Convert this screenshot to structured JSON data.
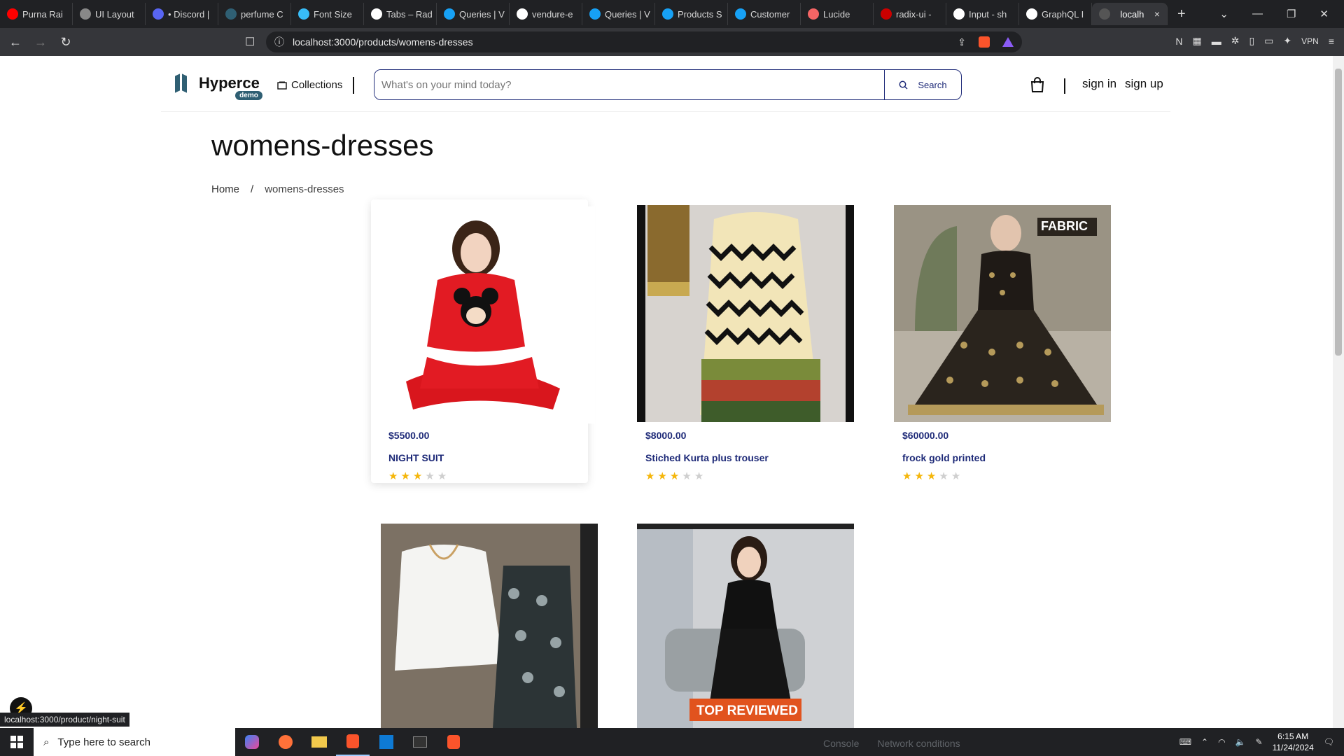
{
  "browser": {
    "tabs": [
      {
        "label": "Purna Rai",
        "color": "#ff0000"
      },
      {
        "label": "UI Layout",
        "color": "#888888"
      },
      {
        "label": "• Discord |",
        "color": "#5865f2"
      },
      {
        "label": "perfume C",
        "color": "#2f5f73"
      },
      {
        "label": "Font Size",
        "color": "#38bdf8"
      },
      {
        "label": "Tabs – Rad",
        "color": "#ffffff"
      },
      {
        "label": "Queries | V",
        "color": "#17a1f5"
      },
      {
        "label": "vendure-e",
        "color": "#ffffff"
      },
      {
        "label": "Queries | V",
        "color": "#17a1f5"
      },
      {
        "label": "Products S",
        "color": "#17a1f5"
      },
      {
        "label": "Customer",
        "color": "#17a1f5"
      },
      {
        "label": "Lucide",
        "color": "#f56565"
      },
      {
        "label": "radix-ui -",
        "color": "#cc0000"
      },
      {
        "label": "Input - sh",
        "color": "#ffffff"
      },
      {
        "label": "GraphQL I",
        "color": "#ffffff"
      }
    ],
    "active_tab": "localh",
    "url": "localhost:3000/products/womens-dresses",
    "vpn_label": "VPN",
    "status_url": "localhost:3000/product/night-suit"
  },
  "header": {
    "brand": "Hyperce",
    "badge": "demo",
    "collections_label": "Collections",
    "search_placeholder": "What's on your mind today?",
    "search_button": "Search",
    "sign_in": "sign in",
    "sign_up": "sign up"
  },
  "page": {
    "title": "womens-dresses",
    "breadcrumb": {
      "home": "Home",
      "sep": "/",
      "current": "womens-dresses"
    }
  },
  "products": [
    {
      "price": "$5500.00",
      "name": "NIGHT SUIT",
      "rating": 3
    },
    {
      "price": "$8000.00",
      "name": "Stiched Kurta plus trouser",
      "rating": 3
    },
    {
      "price": "$60000.00",
      "name": "frock gold printed",
      "rating": 3
    },
    {
      "price": "",
      "name": "",
      "rating": 0
    },
    {
      "price": "",
      "name": "",
      "rating": 0
    }
  ],
  "image_overlays": {
    "fabric": "FABRIC",
    "top_reviewed": "TOP REVIEWED"
  },
  "taskbar": {
    "search_placeholder": "Type here to search",
    "time": "6:15 AM",
    "date": "11/24/2024",
    "devtools_console": "Console",
    "devtools_network": "Network conditions"
  },
  "icons": [
    "search-icon",
    "cart-icon",
    "collections-icon",
    "star-icon",
    "bookmark-icon",
    "reload-icon",
    "share-icon",
    "windows-icon"
  ]
}
